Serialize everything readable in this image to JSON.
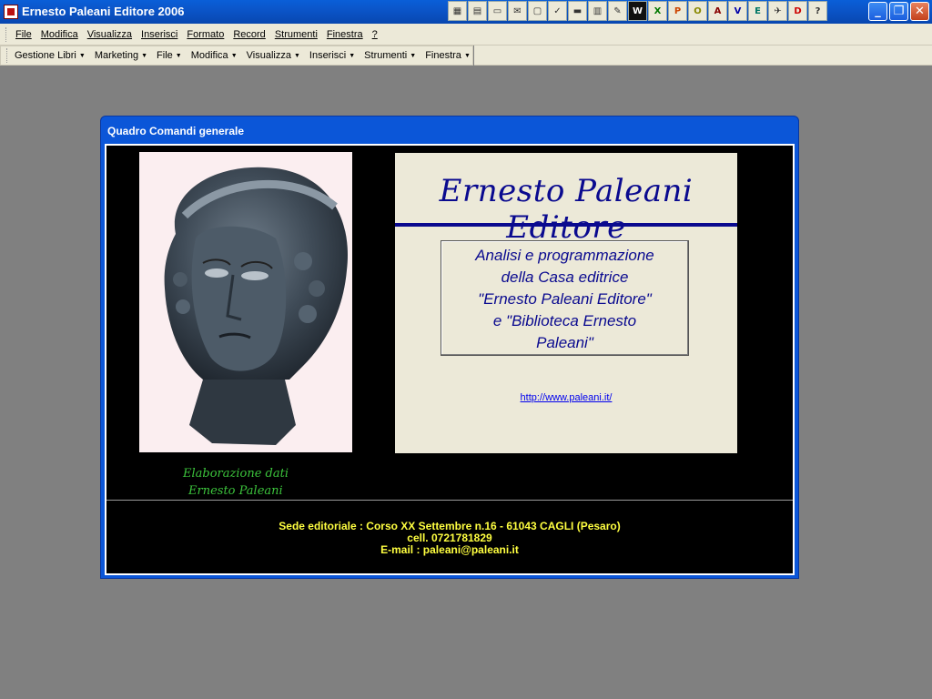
{
  "window": {
    "title": "Ernesto Paleani Editore 2006"
  },
  "toolbar_icons": [
    "grid",
    "db",
    "folder",
    "mail",
    "page",
    "note",
    "card",
    "docs",
    "pencil",
    "W",
    "X",
    "P",
    "O",
    "A",
    "V",
    "E",
    "bird",
    "D",
    "?"
  ],
  "menubar": {
    "items": [
      "File",
      "Modifica",
      "Visualizza",
      "Inserisci",
      "Formato",
      "Record",
      "Strumenti",
      "Finestra",
      "?"
    ]
  },
  "custom_toolbar": {
    "items": [
      "Gestione Libri",
      "Marketing",
      "File",
      "Modifica",
      "Visualizza",
      "Inserisci",
      "Strumenti",
      "Finestra",
      "?"
    ]
  },
  "form": {
    "title": "Quadro Comandi generale",
    "publisher_name": "Ernesto Paleani Editore",
    "description_lines": [
      "Analisi e programmazione",
      "della Casa editrice",
      "\"Ernesto Paleani Editore\"",
      "e  \"Biblioteca Ernesto",
      "Paleani\""
    ],
    "website": "http://www.paleani.it/",
    "credit_line1": "Elaborazione dati",
    "credit_line2": "Ernesto Paleani",
    "footer": {
      "address": "Sede editoriale : Corso XX Settembre n.16 - 61043 CAGLI (Pesaro)",
      "phone": "cell. 0721781829",
      "email": "E-mail : paleani@paleani.it"
    }
  },
  "colors": {
    "desktop": "#808080",
    "accent_blue": "#0a0a8f",
    "credit_green": "#3cc43c",
    "footer_yellow": "#ffff40"
  }
}
